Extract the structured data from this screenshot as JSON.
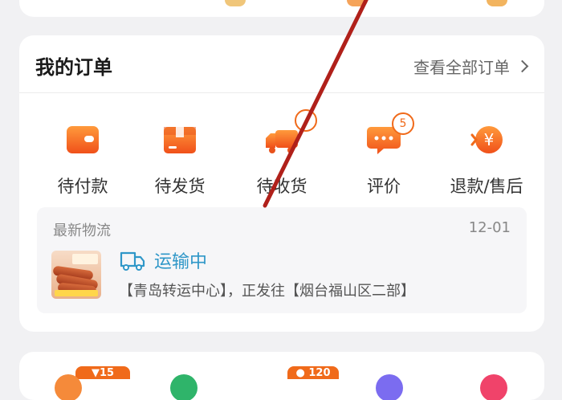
{
  "orders": {
    "title": "我的订单",
    "view_all": "查看全部订单",
    "statuses": [
      {
        "label": "待付款",
        "icon": "wallet-icon"
      },
      {
        "label": "待发货",
        "icon": "package-icon"
      },
      {
        "label": "待收货",
        "icon": "delivery-truck-icon"
      },
      {
        "label": "评价",
        "icon": "comment-icon",
        "badge": "5"
      },
      {
        "label": "退款/售后",
        "icon": "refund-yen-icon"
      }
    ]
  },
  "logistics": {
    "title": "最新物流",
    "date": "12-01",
    "status": "运输中",
    "route": "【青岛转运中心】，正发往【烟台福山区二部】"
  },
  "bottom_promos": [
    {
      "badge": "15",
      "color": "#f06a1a"
    },
    {
      "badge": "120",
      "color": "#f06a1a"
    }
  ],
  "colors": {
    "accent_orange": "#f06a1a",
    "transit_blue": "#2f97c8",
    "overlay_red": "#b0201a"
  }
}
